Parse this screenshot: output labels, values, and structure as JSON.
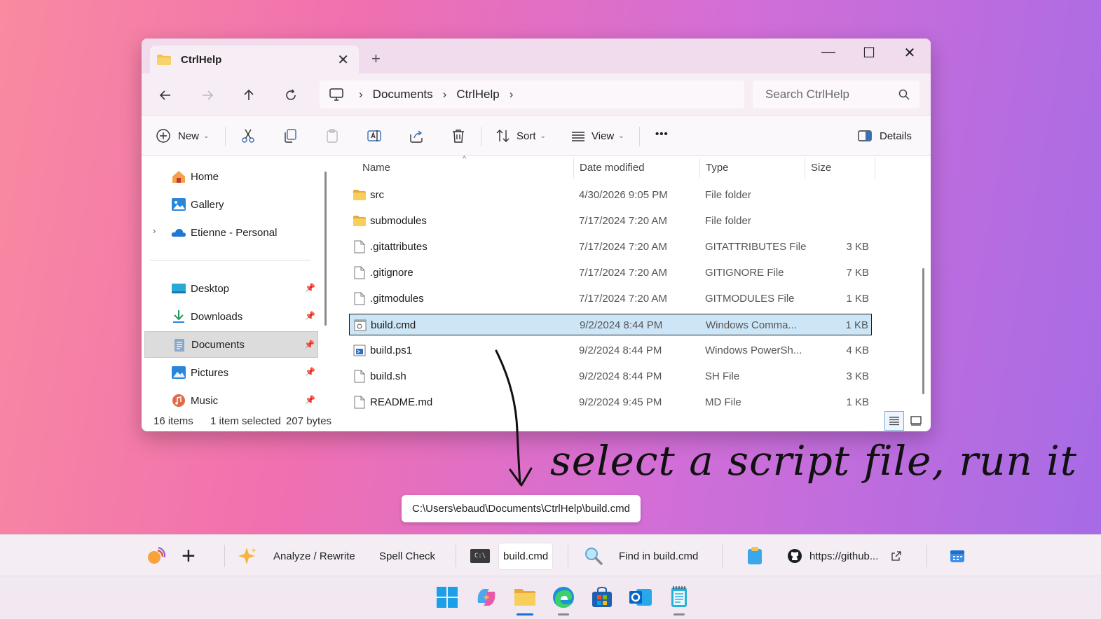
{
  "window": {
    "tab_title": "CtrlHelp",
    "tab_close": "✕",
    "new_tab": "+",
    "minimize": "—",
    "maximize": "☐",
    "close": "✕"
  },
  "navigation": {
    "breadcrumbs": [
      "Documents",
      "CtrlHelp"
    ],
    "search_placeholder": "Search CtrlHelp"
  },
  "command_bar": {
    "new_label": "New",
    "sort_label": "Sort",
    "view_label": "View",
    "more_label": "•••",
    "details_label": "Details"
  },
  "sidebar": {
    "items": [
      {
        "label": "Home",
        "icon": "home-icon"
      },
      {
        "label": "Gallery",
        "icon": "gallery-icon"
      },
      {
        "label": "Etienne - Personal",
        "icon": "onedrive-icon"
      },
      {
        "label": "Desktop",
        "icon": "desktop-icon"
      },
      {
        "label": "Downloads",
        "icon": "downloads-icon"
      },
      {
        "label": "Documents",
        "icon": "documents-icon"
      },
      {
        "label": "Pictures",
        "icon": "pictures-icon"
      },
      {
        "label": "Music",
        "icon": "music-icon"
      }
    ]
  },
  "file_list": {
    "columns": [
      "Name",
      "Date modified",
      "Type",
      "Size"
    ],
    "rows": [
      {
        "name": "src",
        "date": "4/30/2026 9:05 PM",
        "type": "File folder",
        "size": "",
        "icon": "folder"
      },
      {
        "name": "submodules",
        "date": "7/17/2024 7:20 AM",
        "type": "File folder",
        "size": "",
        "icon": "folder"
      },
      {
        "name": ".gitattributes",
        "date": "7/17/2024 7:20 AM",
        "type": "GITATTRIBUTES File",
        "size": "3 KB",
        "icon": "file"
      },
      {
        "name": ".gitignore",
        "date": "7/17/2024 7:20 AM",
        "type": "GITIGNORE File",
        "size": "7 KB",
        "icon": "file"
      },
      {
        "name": ".gitmodules",
        "date": "7/17/2024 7:20 AM",
        "type": "GITMODULES File",
        "size": "1 KB",
        "icon": "file"
      },
      {
        "name": "build.cmd",
        "date": "9/2/2024 8:44 PM",
        "type": "Windows Comma...",
        "size": "1 KB",
        "icon": "cmd"
      },
      {
        "name": "build.ps1",
        "date": "9/2/2024 8:44 PM",
        "type": "Windows PowerSh...",
        "size": "4 KB",
        "icon": "ps1"
      },
      {
        "name": "build.sh",
        "date": "9/2/2024 8:44 PM",
        "type": "SH File",
        "size": "3 KB",
        "icon": "file"
      },
      {
        "name": "README.md",
        "date": "9/2/2024 9:45 PM",
        "type": "MD File",
        "size": "1 KB",
        "icon": "file"
      }
    ],
    "selected_index": 5
  },
  "status": {
    "item_count": "16 items",
    "selection": "1 item selected",
    "bytes": "207 bytes"
  },
  "annotation": {
    "text": "select a script file, run it"
  },
  "tooltip": {
    "path": "C:\\Users\\ebaud\\Documents\\CtrlHelp\\build.cmd"
  },
  "helpbar": {
    "add": "+",
    "analyze": "Analyze / Rewrite",
    "spell": "Spell Check",
    "cmd_file": "build.cmd",
    "find": "Find in build.cmd",
    "github": "https://github...",
    "cmd_badge": "C:\\"
  }
}
